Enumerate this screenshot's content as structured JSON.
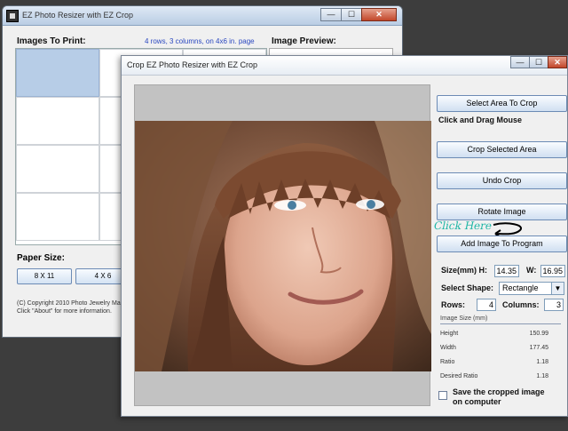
{
  "back_window": {
    "title": "EZ Photo Resizer with EZ Crop",
    "controls": {
      "minimize": "—",
      "maximize": "☐",
      "close": "✕"
    },
    "images_label": "Images To Print:",
    "layout_info": "4 rows, 3 columns, on 4x6 in. page",
    "preview_label": "Image Preview:",
    "paper_size_label": "Paper Size:",
    "paper_buttons": [
      "8 X 11",
      "4 X 6"
    ],
    "copyright_line1": "(C) Copyright 2010 Photo Jewelry Ma",
    "copyright_line2": "Click \"About\" for more information."
  },
  "crop_window": {
    "title": "Crop EZ Photo Resizer with EZ Crop",
    "controls": {
      "minimize": "—",
      "maximize": "☐",
      "close": "✕"
    },
    "buttons": {
      "select_area": "Select Area To Crop",
      "crop_selected": "Crop Selected Area",
      "undo_crop": "Undo Crop",
      "rotate": "Rotate Image",
      "add_to_program": "Add Image To Program"
    },
    "hint": "Click and Drag Mouse",
    "click_here": "Click Here",
    "size_label": "Size(mm) H:",
    "size_h": "14.35",
    "w_label": "W:",
    "size_w": "16.95",
    "shape_label": "Select Shape:",
    "shape_value": "Rectangle",
    "rows_label": "Rows:",
    "rows_value": "4",
    "columns_label": "Columns:",
    "columns_value": "3",
    "image_size_title": "Image Size (mm)",
    "image_size": [
      {
        "label": "Height",
        "value": "150.99"
      },
      {
        "label": "Width",
        "value": "177.45"
      },
      {
        "label": "Ratio",
        "value": "1.18"
      },
      {
        "label": "Desired Ratio",
        "value": "1.18"
      }
    ],
    "save_checkbox_label": "Save the cropped image on computer"
  },
  "colors": {
    "selected_cell": "#b7cde7",
    "accent_text": "#2a48c0",
    "click_here": "#1fb6a6"
  }
}
